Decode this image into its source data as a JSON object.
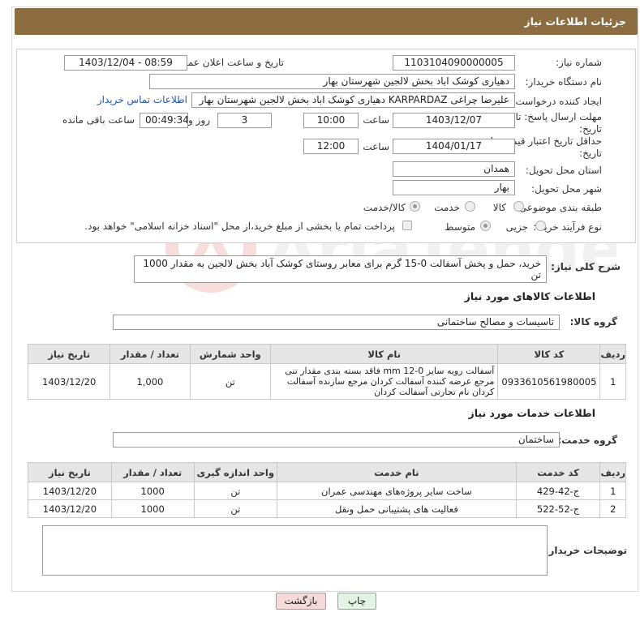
{
  "header": {
    "title": "جزئیات اطلاعات نیاز"
  },
  "form": {
    "need_number_label": "شماره نیاز:",
    "need_number": "1103104090000005",
    "announce_label": "تاریخ و ساعت اعلان عمومی:",
    "announce_value": "1403/12/04 - 08:59",
    "buyer_org_label": "نام دستگاه خریدار:",
    "buyer_org": "دهیاری کوشک اباد بخش لالجین شهرستان بهار",
    "requester_label": "ایجاد کننده درخواست:",
    "requester": "علیرضا چراغی KARPARDAZ دهیاری کوشک اباد بخش لالجین شهرستان بهار",
    "contact_link": "اطلاعات تماس خریدار",
    "deadline_label_1": "مهلت ارسال پاسخ: تا",
    "deadline_label_2": "تاریخ:",
    "deadline_date": "1403/12/07",
    "time_label": "ساعت",
    "deadline_time": "10:00",
    "days_value": "3",
    "days_label": "روز و",
    "remaining_value": "00:49:34",
    "remaining_label": "ساعت باقی مانده",
    "validity_label_1": "حداقل تاریخ اعتبار قیمت: تا",
    "validity_label_2": "تاریخ:",
    "validity_date": "1404/01/17",
    "validity_time": "12:00",
    "province_label": "استان محل تحویل:",
    "province": "همدان",
    "city_label": "شهر محل تحویل:",
    "city": "بهار",
    "category_label": "طبقه بندی موضوعی:",
    "category_options": [
      "کالا",
      "خدمت",
      "کالا/خدمت"
    ],
    "process_label": "نوع فرآیند خرید :",
    "process_options": [
      "جزیی",
      "متوسط"
    ],
    "payment_note": "پرداخت تمام یا بخشی از مبلغ خرید،از محل \"اسناد خزانه اسلامی\" خواهد بود."
  },
  "summary": {
    "label": "شرح کلی نیاز:",
    "text": "خرید، حمل و پخش آسفالت 0-15 گرم برای معابر روستای کوشک آباد بخش لالجین به مقدار 1000 تن"
  },
  "goods": {
    "title": "اطلاعات کالاهای مورد نیاز",
    "group_label": "گروه کالا:",
    "group_value": "تاسیسات و مصالح ساختمانی",
    "columns": [
      "ردیف",
      "کد کالا",
      "نام کالا",
      "واحد شمارش",
      "تعداد / مقدار",
      "تاریخ نیاز"
    ],
    "rows": [
      {
        "row": "1",
        "code": "0933610561980005",
        "name": "آسفالت رویه سایز mm 12-0 فاقد بسته بندی مقدار تنی مرجع عرضه کننده آسفالت کردان مرجع سازنده آسفالت کردان نام تجارتی آسفالت کردان",
        "unit": "تن",
        "qty": "1,000",
        "date": "1403/12/20"
      }
    ]
  },
  "services": {
    "title": "اطلاعات خدمات مورد نیاز",
    "group_label": "گروه خدمت:",
    "group_value": "ساختمان",
    "columns": [
      "ردیف",
      "کد خدمت",
      "نام خدمت",
      "واحد اندازه گیری",
      "تعداد / مقدار",
      "تاریخ نیاز"
    ],
    "rows": [
      {
        "row": "1",
        "code": "ج-42-429",
        "name": "ساخت سایر پروژه‌های مهندسی عمران",
        "unit": "تن",
        "qty": "1000",
        "date": "1403/12/20"
      },
      {
        "row": "2",
        "code": "ج-52-522",
        "name": "فعالیت های پشتیبانی حمل ونقل",
        "unit": "تن",
        "qty": "1000",
        "date": "1403/12/20"
      }
    ]
  },
  "buyer_notes": {
    "label": "توضیحات خریدار:"
  },
  "buttons": {
    "print": "چاپ",
    "back": "بازگشت"
  },
  "colors": {
    "header": "#8b6d41",
    "back_button": "#f6d9d9",
    "print_button": "#e3f3e3"
  }
}
